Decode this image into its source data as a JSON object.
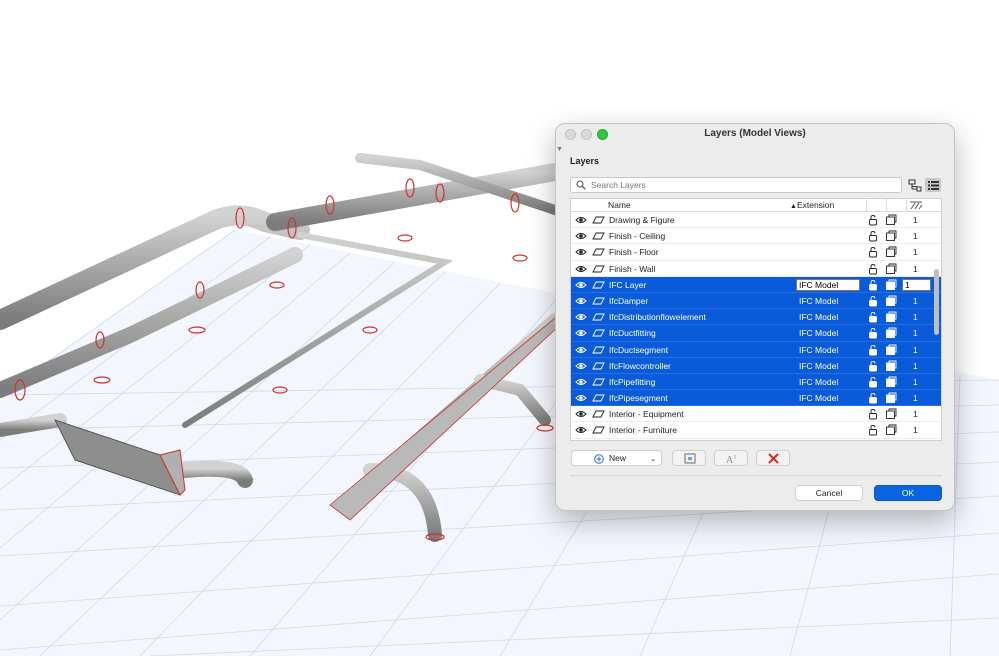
{
  "dialog": {
    "title": "Layers (Model Views)",
    "section_label": "Layers",
    "search_placeholder": "Search Layers",
    "columns": {
      "name": "Name",
      "extension": "Extension"
    },
    "rows": [
      {
        "name": "Drawing & Figure",
        "extension": "",
        "num": "1",
        "selected": false
      },
      {
        "name": "Finish - Ceiling",
        "extension": "",
        "num": "1",
        "selected": false
      },
      {
        "name": "Finish - Floor",
        "extension": "",
        "num": "1",
        "selected": false
      },
      {
        "name": "Finish - Wall",
        "extension": "",
        "num": "1",
        "selected": false
      },
      {
        "name": "IFC Layer",
        "extension": "IFC Model",
        "num": "1",
        "selected": true,
        "editing": true
      },
      {
        "name": "IfcDamper",
        "extension": "IFC Model",
        "num": "1",
        "selected": true
      },
      {
        "name": "IfcDistributionflowelement",
        "extension": "IFC Model",
        "num": "1",
        "selected": true
      },
      {
        "name": "IfcDuctfitting",
        "extension": "IFC Model",
        "num": "1",
        "selected": true
      },
      {
        "name": "IfcDuctsegment",
        "extension": "IFC Model",
        "num": "1",
        "selected": true
      },
      {
        "name": "IfcFlowcontroller",
        "extension": "IFC Model",
        "num": "1",
        "selected": true
      },
      {
        "name": "IfcPipefitting",
        "extension": "IFC Model",
        "num": "1",
        "selected": true
      },
      {
        "name": "IfcPipesegment",
        "extension": "IFC Model",
        "num": "1",
        "selected": true
      },
      {
        "name": "Interior - Equipment",
        "extension": "",
        "num": "1",
        "selected": false
      },
      {
        "name": "Interior - Furniture",
        "extension": "",
        "num": "1",
        "selected": false
      }
    ],
    "buttons": {
      "new": "New",
      "cancel": "Cancel",
      "ok": "OK"
    }
  },
  "colors": {
    "selection": "#0a5bd9",
    "ok_button": "#0a64e0",
    "pipe": "#a9a9a9",
    "pipe_accent": "#d0312d",
    "grid": "#c9d4ee"
  },
  "icons": [
    "eye-icon",
    "layer-type-icon",
    "lock-icon",
    "wireframe-icon",
    "search-icon",
    "tree-view-icon",
    "list-view-icon",
    "plus-icon",
    "layer-settings-icon",
    "text-style-icon",
    "delete-icon"
  ]
}
